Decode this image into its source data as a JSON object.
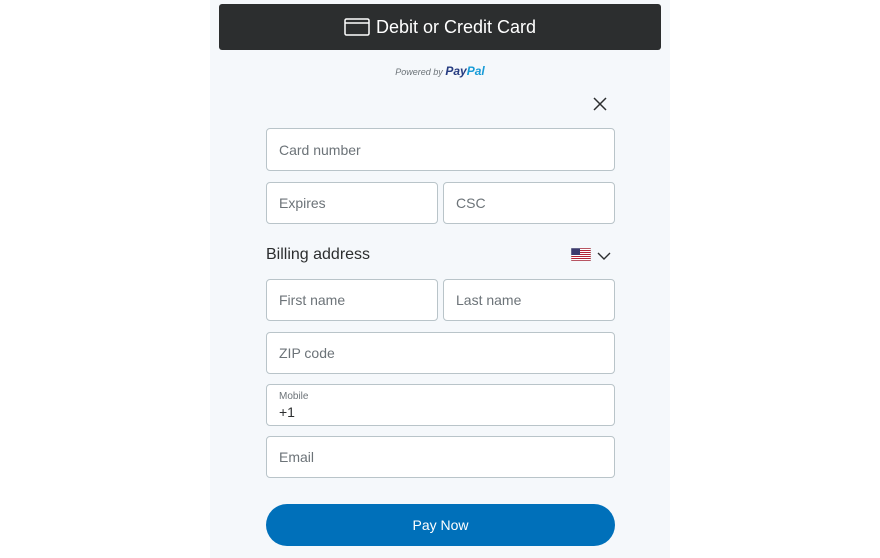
{
  "header": {
    "title": "Debit or Credit Card"
  },
  "powered_by": {
    "prefix": "Powered by",
    "brand_pay": "Pay",
    "brand_pal": "Pal"
  },
  "form": {
    "card_number": {
      "placeholder": "Card number"
    },
    "expires": {
      "placeholder": "Expires"
    },
    "csc": {
      "placeholder": "CSC"
    },
    "billing_label": "Billing address",
    "country_flag": "us-flag-icon",
    "first_name": {
      "placeholder": "First name"
    },
    "last_name": {
      "placeholder": "Last name"
    },
    "zip": {
      "placeholder": "ZIP code"
    },
    "mobile": {
      "label": "Mobile",
      "value": "+1"
    },
    "email": {
      "placeholder": "Email"
    },
    "pay_button": "Pay Now"
  },
  "colors": {
    "header_bg": "#2c2e2f",
    "panel_bg": "#f5f8fb",
    "button_bg": "#0070ba",
    "paypal_dark": "#253b80",
    "paypal_light": "#179bd7"
  }
}
